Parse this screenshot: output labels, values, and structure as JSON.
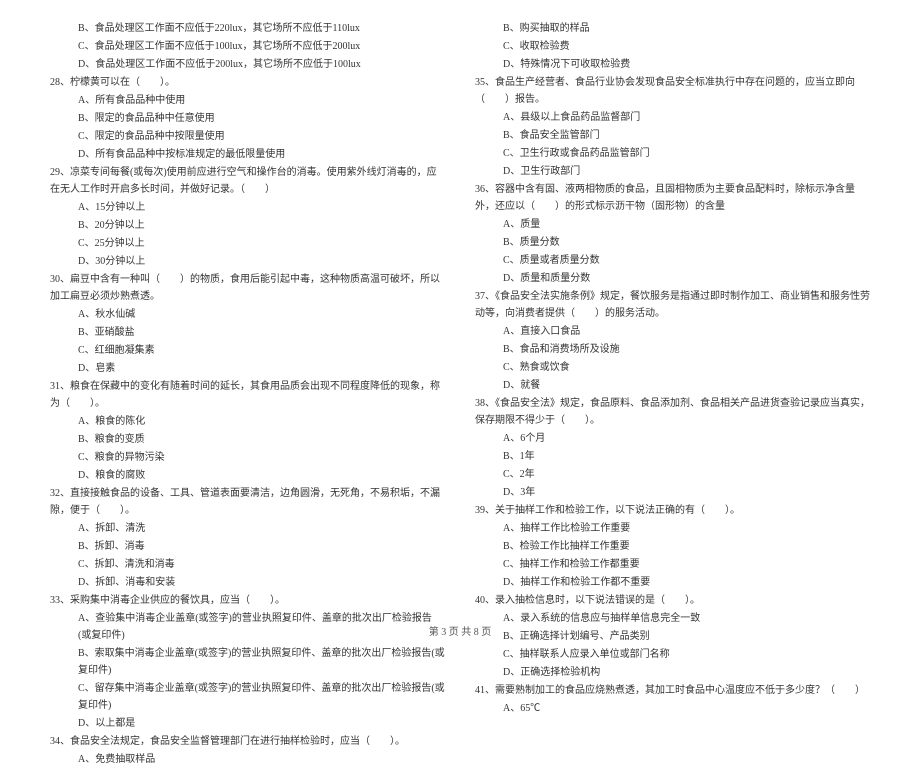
{
  "leftColumn": [
    {
      "cls": "indent1",
      "t": "B、食品处理区工作面不应低于220lux，其它场所不应低于110lux"
    },
    {
      "cls": "indent1",
      "t": "C、食品处理区工作面不应低于100lux，其它场所不应低于200lux"
    },
    {
      "cls": "indent1",
      "t": "D、食品处理区工作面不应低于200lux，其它场所不应低于100lux"
    },
    {
      "cls": "q",
      "t": "28、柠檬黄可以在（　　）。"
    },
    {
      "cls": "indent1",
      "t": "A、所有食品品种中使用"
    },
    {
      "cls": "indent1",
      "t": "B、限定的食品品种中任意使用"
    },
    {
      "cls": "indent1",
      "t": "C、限定的食品品种中按限量使用"
    },
    {
      "cls": "indent1",
      "t": "D、所有食品品种中按标准规定的最低限量使用"
    },
    {
      "cls": "q",
      "t": "29、凉菜专间每餐(或每次)使用前应进行空气和操作台的消毒。使用紫外线灯消毒的，应在无人工作时开启多长时间，并做好记录。（　　）"
    },
    {
      "cls": "indent1",
      "t": "A、15分钟以上"
    },
    {
      "cls": "indent1",
      "t": "B、20分钟以上"
    },
    {
      "cls": "indent1",
      "t": "C、25分钟以上"
    },
    {
      "cls": "indent1",
      "t": "D、30分钟以上"
    },
    {
      "cls": "q",
      "t": "30、扁豆中含有一种叫（　　）的物质，食用后能引起中毒，这种物质高温可破坏，所以加工扁豆必须炒熟煮透。"
    },
    {
      "cls": "indent1",
      "t": "A、秋水仙碱"
    },
    {
      "cls": "indent1",
      "t": "B、亚硝酸盐"
    },
    {
      "cls": "indent1",
      "t": "C、红细胞凝集素"
    },
    {
      "cls": "indent1",
      "t": "D、皂素"
    },
    {
      "cls": "q",
      "t": "31、粮食在保藏中的变化有随着时间的延长，其食用品质会出现不同程度降低的现象，称为（　　）。"
    },
    {
      "cls": "indent1",
      "t": "A、粮食的陈化"
    },
    {
      "cls": "indent1",
      "t": "B、粮食的变质"
    },
    {
      "cls": "indent1",
      "t": "C、粮食的异物污染"
    },
    {
      "cls": "indent1",
      "t": "D、粮食的腐败"
    },
    {
      "cls": "q",
      "t": "32、直接接触食品的设备、工具、管道表面要清洁，边角圆滑，无死角，不易积垢，不漏隙，便于（　　）。"
    },
    {
      "cls": "indent1",
      "t": "A、拆卸、清洗"
    },
    {
      "cls": "indent1",
      "t": "B、拆卸、消毒"
    },
    {
      "cls": "indent1",
      "t": "C、拆卸、清洗和消毒"
    },
    {
      "cls": "indent1",
      "t": "D、拆卸、消毒和安装"
    },
    {
      "cls": "q",
      "t": "33、采购集中消毒企业供应的餐饮具，应当（　　）。"
    },
    {
      "cls": "indent1",
      "t": "A、查验集中消毒企业盖章(或签字)的营业执照复印件、盖章的批次出厂检验报告(或复印件)"
    },
    {
      "cls": "indent1",
      "t": "B、索取集中消毒企业盖章(或签字)的营业执照复印件、盖章的批次出厂检验报告(或复印件)"
    },
    {
      "cls": "indent1",
      "t": "C、留存集中消毒企业盖章(或签字)的营业执照复印件、盖章的批次出厂检验报告(或复印件)"
    },
    {
      "cls": "indent1",
      "t": "D、以上都是"
    },
    {
      "cls": "q",
      "t": "34、食品安全法规定，食品安全监督管理部门在进行抽样检验时，应当（　　）。"
    },
    {
      "cls": "indent1",
      "t": "A、免费抽取样品"
    }
  ],
  "rightColumn": [
    {
      "cls": "indent1",
      "t": "B、购买抽取的样品"
    },
    {
      "cls": "indent1",
      "t": "C、收取检验费"
    },
    {
      "cls": "indent1",
      "t": "D、特殊情况下可收取检验费"
    },
    {
      "cls": "q",
      "t": "35、食品生产经营者、食品行业协会发现食品安全标准执行中存在问题的，应当立即向（　　）报告。"
    },
    {
      "cls": "indent1",
      "t": "A、县级以上食品药品监督部门"
    },
    {
      "cls": "indent1",
      "t": "B、食品安全监管部门"
    },
    {
      "cls": "indent1",
      "t": "C、卫生行政或食品药品监管部门"
    },
    {
      "cls": "indent1",
      "t": "D、卫生行政部门"
    },
    {
      "cls": "q",
      "t": "36、容器中含有固、液两相物质的食品，且固相物质为主要食品配料时，除标示净含量外，还应以（　　）的形式标示沥干物（固形物）的含量"
    },
    {
      "cls": "indent1",
      "t": "A、质量"
    },
    {
      "cls": "indent1",
      "t": "B、质量分数"
    },
    {
      "cls": "indent1",
      "t": "C、质量或者质量分数"
    },
    {
      "cls": "indent1",
      "t": "D、质量和质量分数"
    },
    {
      "cls": "q",
      "t": "37、《食品安全法实施条例》规定，餐饮服务是指通过即时制作加工、商业销售和服务性劳动等，向消费者提供（　　）的服务活动。"
    },
    {
      "cls": "indent1",
      "t": "A、直接入口食品"
    },
    {
      "cls": "indent1",
      "t": "B、食品和消费场所及设施"
    },
    {
      "cls": "indent1",
      "t": "C、熟食或饮食"
    },
    {
      "cls": "indent1",
      "t": "D、就餐"
    },
    {
      "cls": "q",
      "t": "38、《食品安全法》规定，食品原料、食品添加剂、食品相关产品进货查验记录应当真实，保存期限不得少于（　　）。"
    },
    {
      "cls": "indent1",
      "t": "A、6个月"
    },
    {
      "cls": "indent1",
      "t": "B、1年"
    },
    {
      "cls": "indent1",
      "t": "C、2年"
    },
    {
      "cls": "indent1",
      "t": "D、3年"
    },
    {
      "cls": "q",
      "t": "39、关于抽样工作和检验工作，以下说法正确的有（　　）。"
    },
    {
      "cls": "indent1",
      "t": "A、抽样工作比检验工作重要"
    },
    {
      "cls": "indent1",
      "t": "B、检验工作比抽样工作重要"
    },
    {
      "cls": "indent1",
      "t": "C、抽样工作和检验工作都重要"
    },
    {
      "cls": "indent1",
      "t": "D、抽样工作和检验工作都不重要"
    },
    {
      "cls": "q",
      "t": "40、录入抽检信息时，以下说法错误的是（　　）。"
    },
    {
      "cls": "indent1",
      "t": "A、录入系统的信息应与抽样单信息完全一致"
    },
    {
      "cls": "indent1",
      "t": "B、正确选择计划编号、产品类别"
    },
    {
      "cls": "indent1",
      "t": "C、抽样联系人应录入单位或部门名称"
    },
    {
      "cls": "indent1",
      "t": "D、正确选择检验机构"
    },
    {
      "cls": "q",
      "t": "41、需要熟制加工的食品应烧熟煮透，其加工时食品中心温度应不低于多少度？（　　）"
    },
    {
      "cls": "indent1",
      "t": "A、65℃"
    }
  ],
  "footer": "第 3 页 共 8 页"
}
